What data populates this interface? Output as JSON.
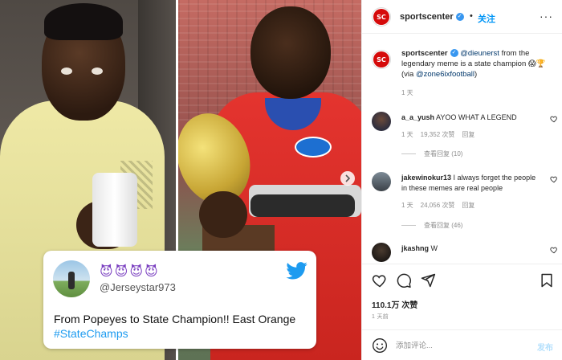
{
  "post": {
    "tweet": {
      "emojis": "😈😈😈😈",
      "handle": "@Jerseystar973",
      "text": "From Popeyes to State Champion!! East Orange ",
      "hashtag": "#StateChamps"
    }
  },
  "header": {
    "logo_text": "SC",
    "username": "sportscenter",
    "separator": "•",
    "follow_label": "关注",
    "more": "···"
  },
  "caption": {
    "username": "sportscenter",
    "mention1": "@dieunerst",
    "text1": " from the legendary meme is a state champion 😱🏆",
    "prefix": "(via ",
    "mention2": "@zone6ixfootball",
    "suffix": ")",
    "time": "1 天"
  },
  "comments": [
    {
      "username": "a_a_yush",
      "text": "AYOO WHAT A LEGEND",
      "time": "1 天",
      "likes": "19,352 次赞",
      "reply": "回复",
      "view_replies": "查看回复 (10)"
    },
    {
      "username": "jakewinokur13",
      "text": "I always forget the people in these memes are real people",
      "time": "1 天",
      "likes": "24,056 次赞",
      "reply": "回复",
      "view_replies": "查看回复 (46)"
    },
    {
      "username": "jkashng",
      "text": "W"
    }
  ],
  "likes_count": "110.1万 次赞",
  "post_time": "1 天前",
  "compose": {
    "placeholder": "添加评论...",
    "post_label": "发布"
  },
  "colors": {
    "link_blue": "#0095f6",
    "espn_red": "#d50a0a",
    "twitter_blue": "#1d9bf0"
  }
}
